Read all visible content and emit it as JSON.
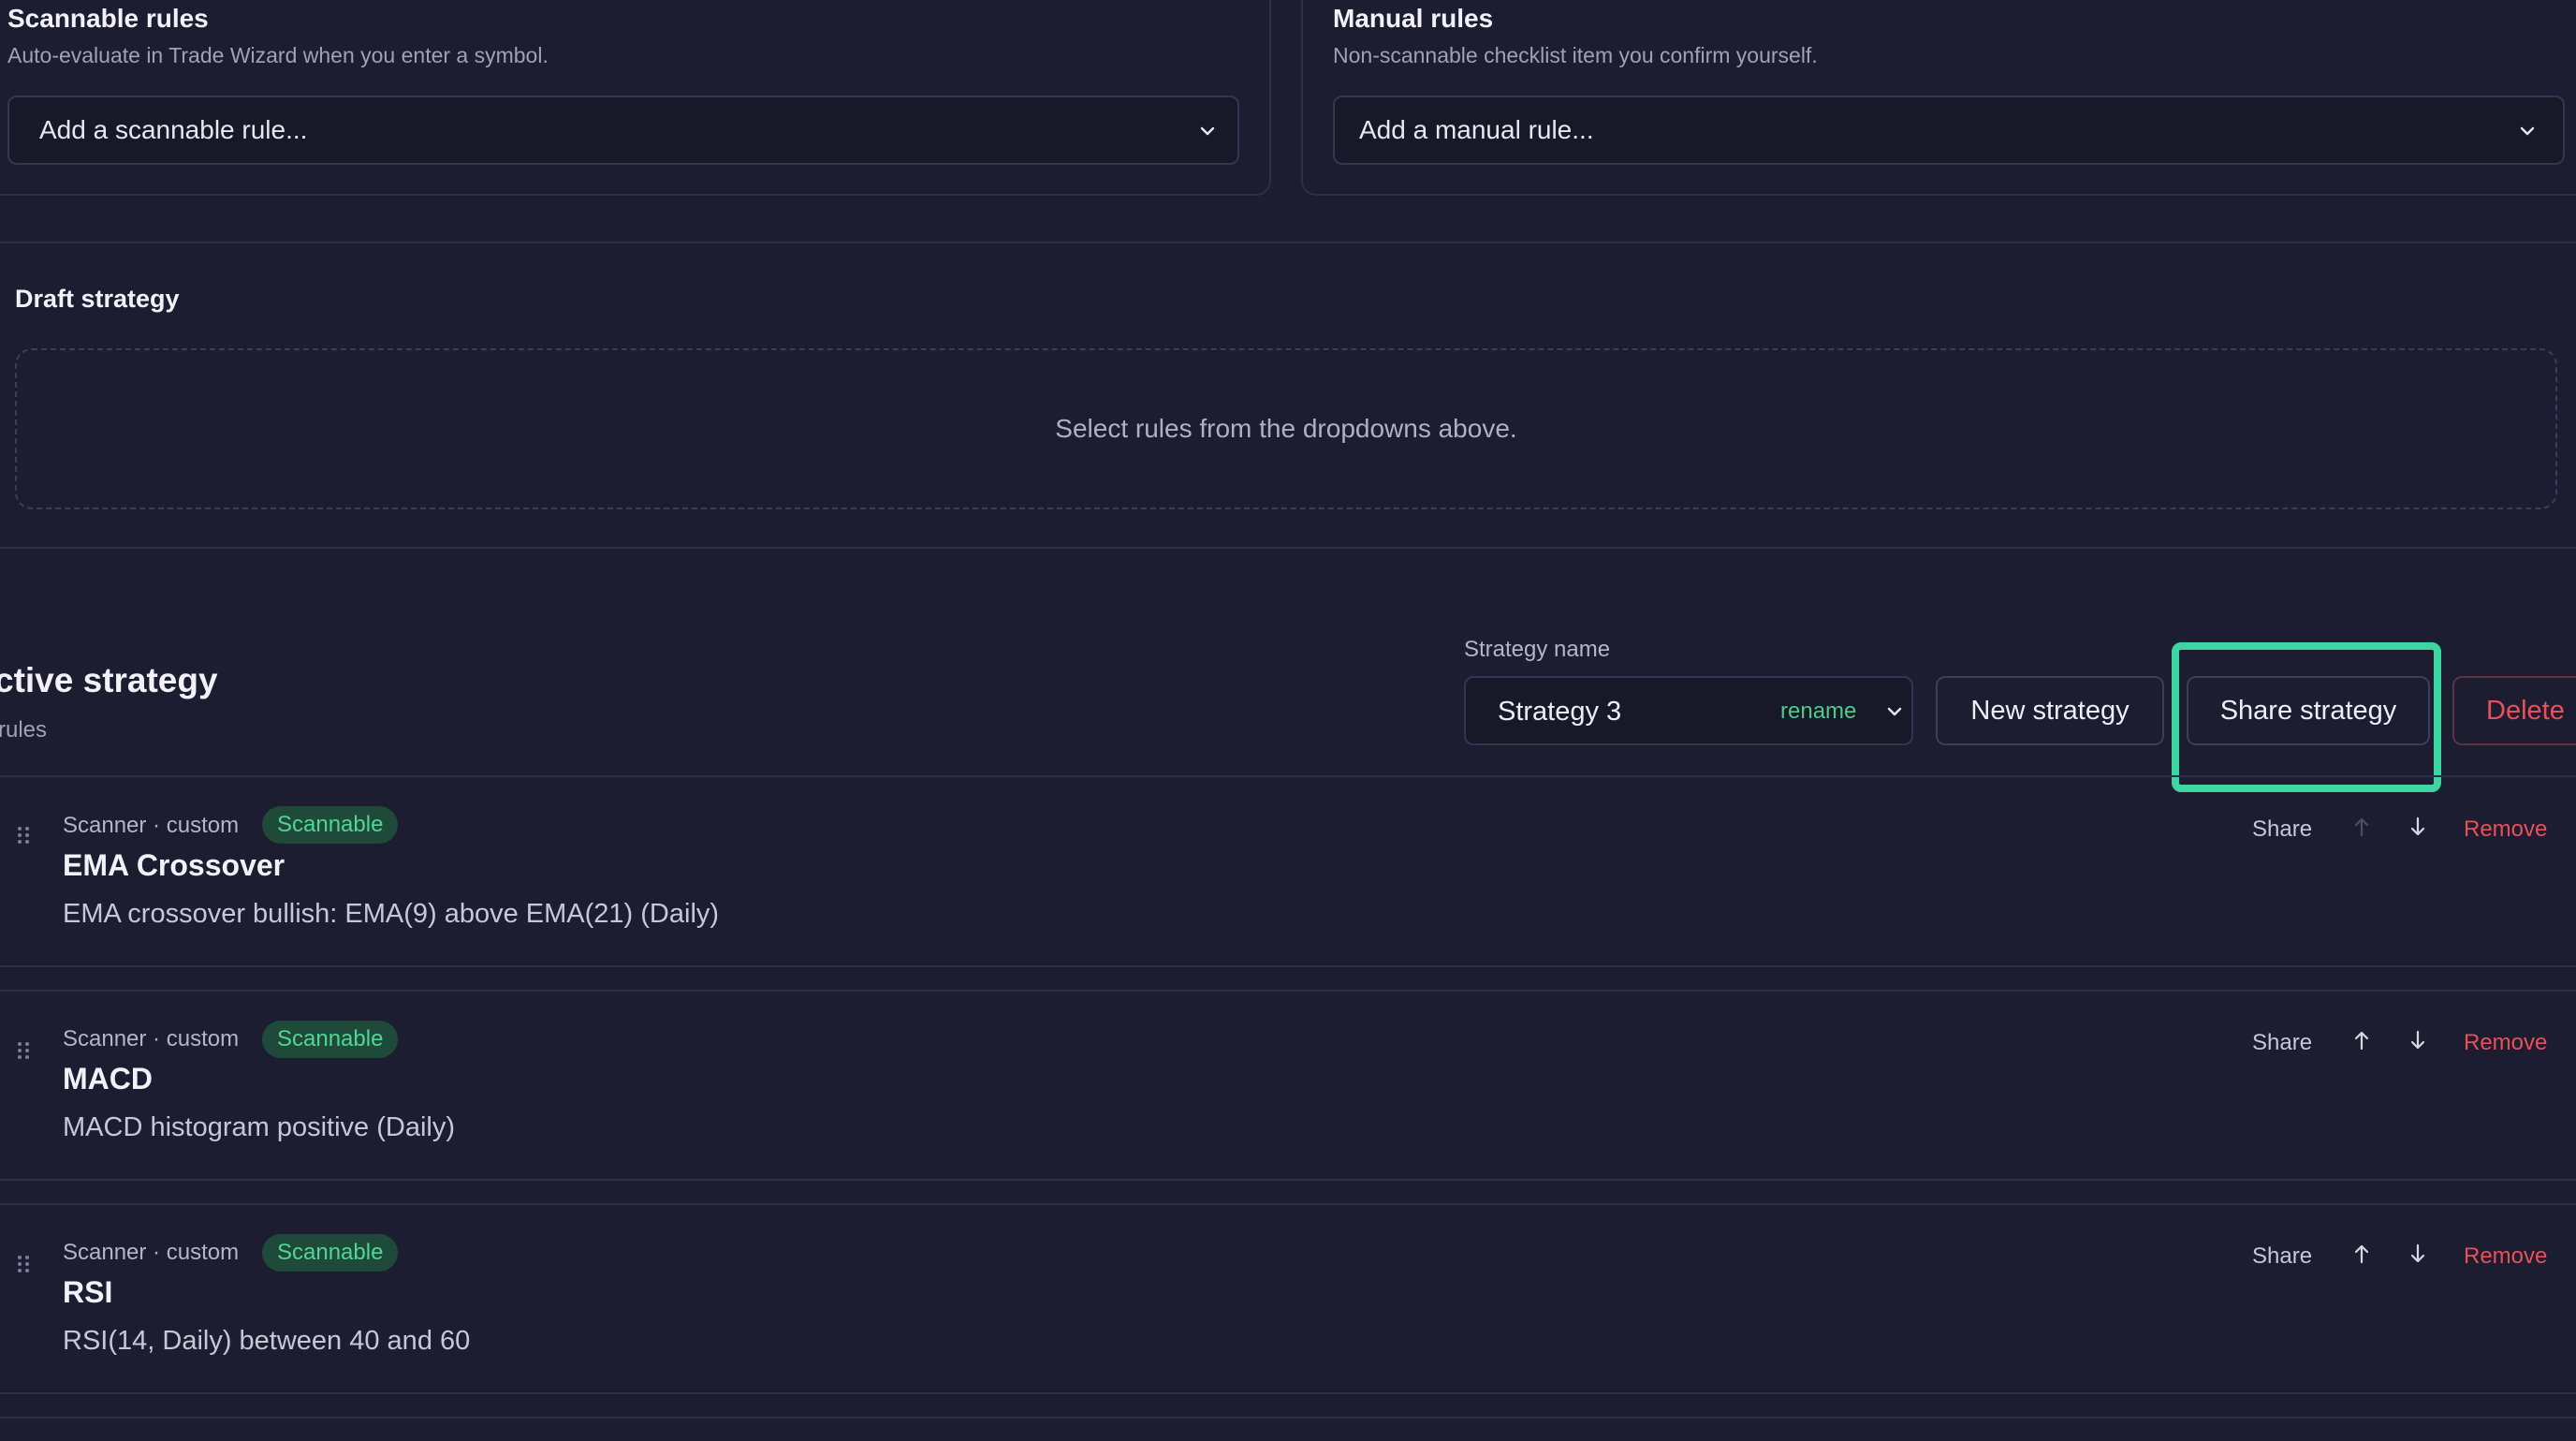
{
  "scannable": {
    "title": "Scannable rules",
    "subtitle": "Auto-evaluate in Trade Wizard when you enter a symbol.",
    "select_value": "Add a scannable rule..."
  },
  "manual": {
    "title": "Manual rules",
    "subtitle": "Non-scannable checklist item you confirm yourself.",
    "select_value": "Add a manual rule..."
  },
  "draft": {
    "title": "Draft strategy",
    "empty_text": "Select rules from the dropdowns above."
  },
  "active": {
    "title": "ctive strategy",
    "subtitle": "rules",
    "field_label": "Strategy name",
    "strategy_name": "Strategy 3",
    "rename_label": "rename",
    "new_button": "New strategy",
    "share_button": "Share strategy",
    "delete_button": "Delete"
  },
  "rules": [
    {
      "meta": "Scanner · custom",
      "badge": "Scannable",
      "title": "EMA Crossover",
      "description": "EMA crossover bullish: EMA(9) above EMA(21) (Daily)",
      "share": "Share",
      "remove": "Remove",
      "up_disabled": true
    },
    {
      "meta": "Scanner · custom",
      "badge": "Scannable",
      "title": "MACD",
      "description": "MACD histogram positive (Daily)",
      "share": "Share",
      "remove": "Remove",
      "up_disabled": false
    },
    {
      "meta": "Scanner · custom",
      "badge": "Scannable",
      "title": "RSI",
      "description": "RSI(14, Daily) between 40 and 60",
      "share": "Share",
      "remove": "Remove",
      "up_disabled": false
    }
  ],
  "colors": {
    "background": "#1c1d30",
    "highlight": "#3ed6a0",
    "accent_green": "#4fd694",
    "danger": "#e8505b"
  }
}
